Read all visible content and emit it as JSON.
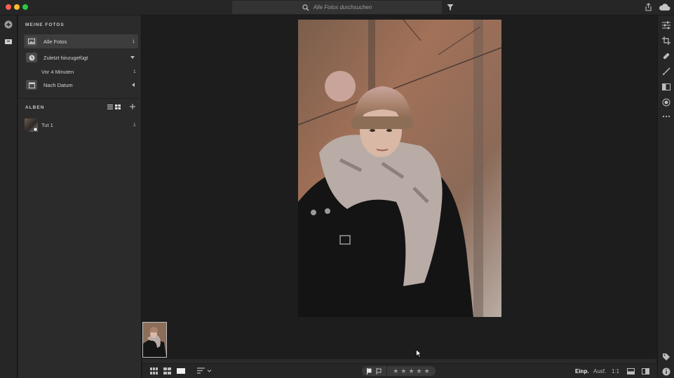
{
  "titlebar": {
    "search_placeholder": "Alle Fotos durchsuchen"
  },
  "sidebar": {
    "section_title": "MEINE FOTOS",
    "items": [
      {
        "label": "Alle Fotos",
        "count": "1",
        "icon": "photo-icon"
      },
      {
        "label": "Zuletzt hinzugefügt",
        "icon": "clock-icon"
      },
      {
        "label": "Nach Datum",
        "icon": "calendar-icon"
      }
    ],
    "recent_sub": {
      "label": "Vor 4 Minuten",
      "count": "1"
    },
    "albums_title": "ALBEN",
    "albums": [
      {
        "label": "Tut 1",
        "count": "1"
      }
    ]
  },
  "bottombar": {
    "fit_label": "Einp.",
    "fill_label": "Ausf.",
    "zoom_label": "1:1",
    "rating_stars": 5
  },
  "colors": {
    "background": "#1d1d1d",
    "panel": "#2b2b2b",
    "active_item": "#3d3d3d"
  }
}
